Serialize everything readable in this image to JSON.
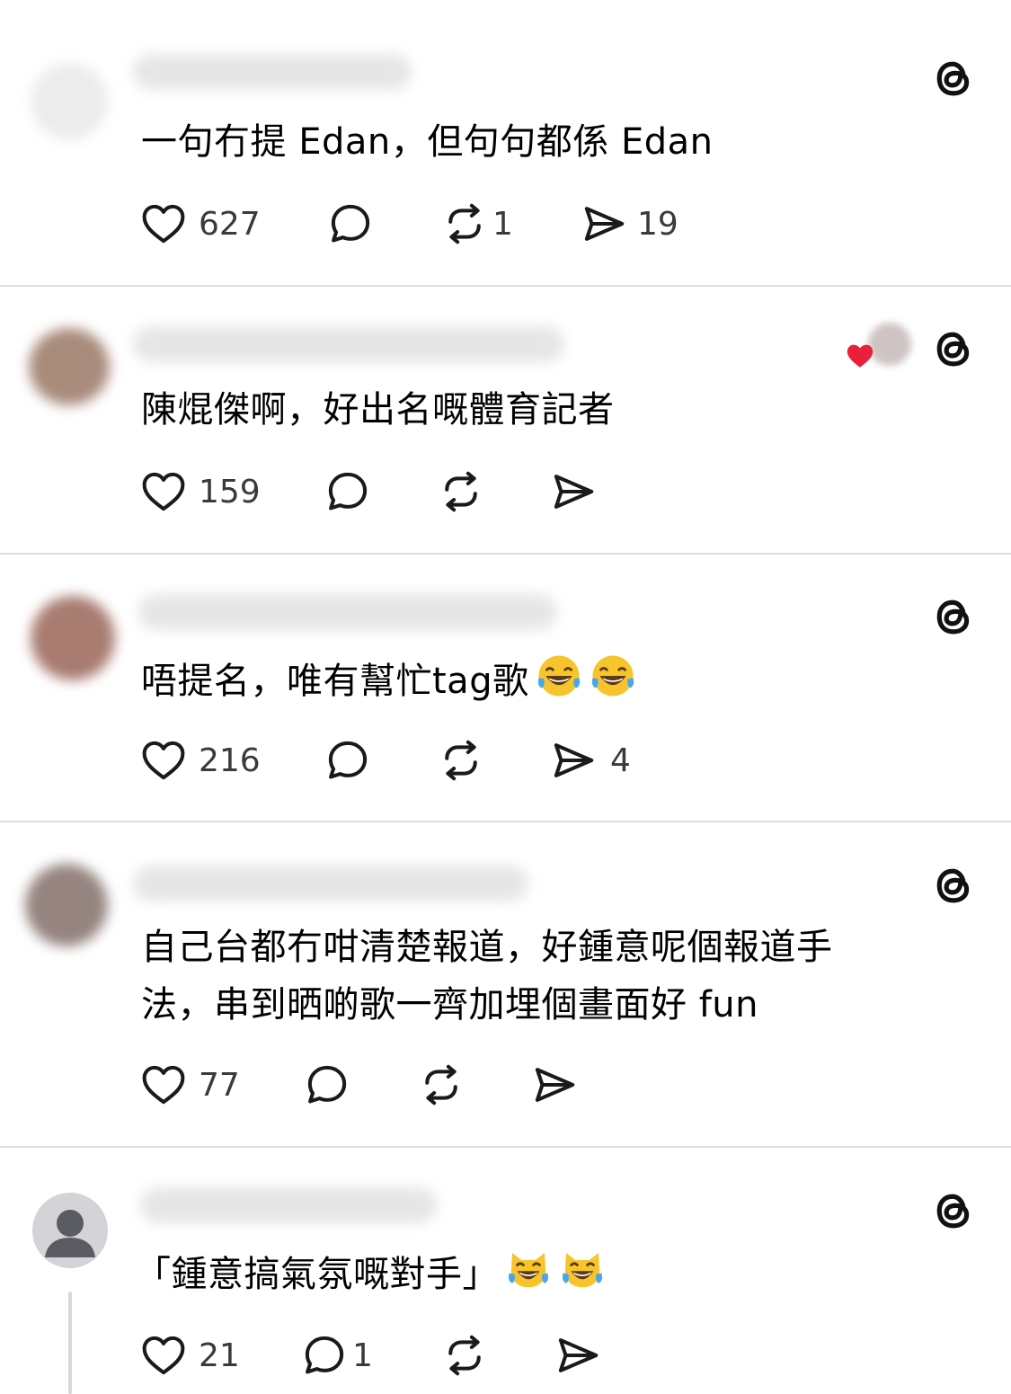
{
  "posts": [
    {
      "text": "一句冇提 Edan，但句句都係 Edan",
      "likes": "627",
      "replies": "",
      "reposts": "1",
      "shares": "19",
      "avatar_color": "#e8e8e8"
    },
    {
      "text": "陳焜傑啊，好出名嘅體育記者",
      "likes": "159",
      "replies": "",
      "reposts": "",
      "shares": "",
      "avatar_color": "#a08070"
    },
    {
      "text": "唔提名，唯有幫忙tag歌",
      "likes": "216",
      "replies": "",
      "reposts": "",
      "shares": "4",
      "avatar_color": "#a07060"
    },
    {
      "text_line1": "自己台都冇咁清楚報道，好鍾意呢個報道手",
      "text_line2": "法，串到晒啲歌一齊加埋個畫面好 fun",
      "likes": "77",
      "replies": "",
      "reposts": "",
      "shares": "",
      "avatar_color": "#8a7a78"
    },
    {
      "text": "「鍾意搞氣氛嘅對手」",
      "likes": "21",
      "replies": "1",
      "reposts": "",
      "shares": "",
      "avatar_color": "#d0d0d4"
    }
  ],
  "icons": {
    "like": "heart-outline-icon",
    "reply": "speech-bubble-icon",
    "repost": "repost-arrows-icon",
    "share": "paper-plane-icon",
    "brand": "threads-logo-icon",
    "emoji_laugh": "face-with-tears-of-joy",
    "emoji_cat": "cat-with-tears-of-joy"
  },
  "colors": {
    "icon": "#1a1a1a",
    "count": "#3a3a3a",
    "divider": "#dcdcdc",
    "heart_badge": "#e8203a"
  }
}
